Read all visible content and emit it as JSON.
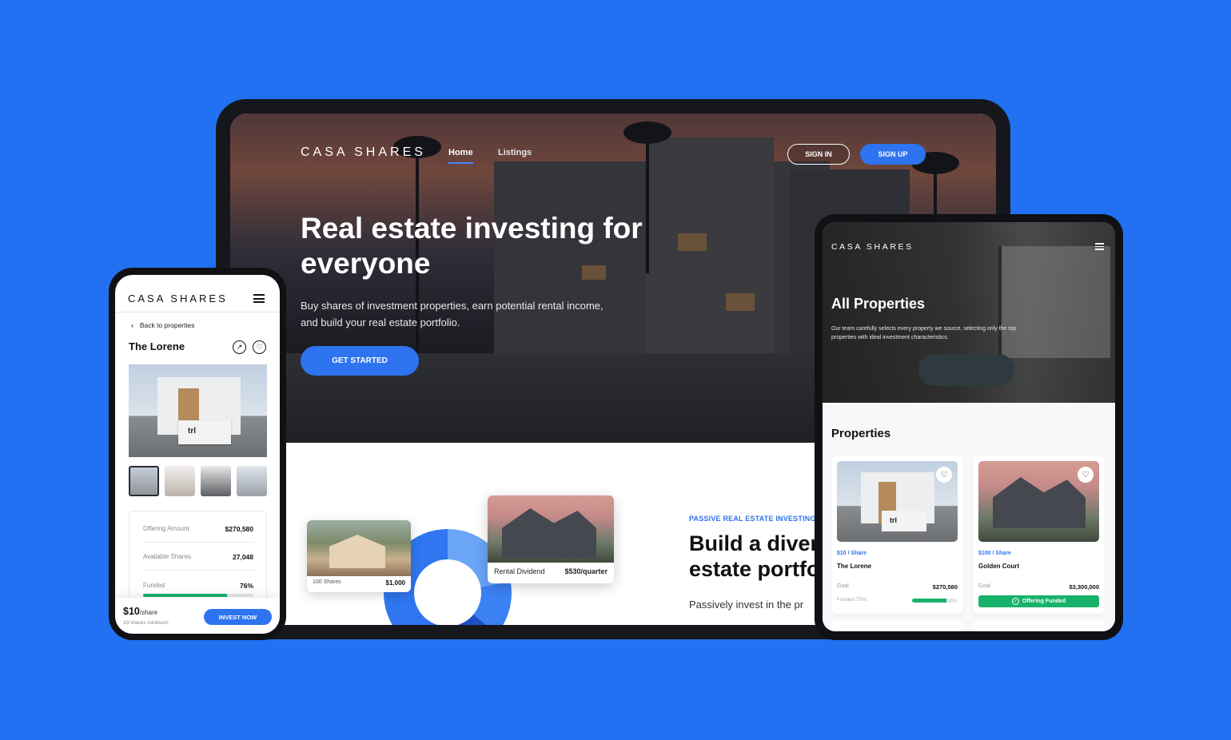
{
  "laptop": {
    "brand": "CASA SHARES",
    "nav": {
      "home": "Home",
      "listings": "Listings"
    },
    "sign_in": "SIGN IN",
    "sign_up": "SIGN UP",
    "hero_title": "Real estate investing for everyone",
    "hero_subtitle": "Buy shares of investment properties, earn potential rental income, and build your real estate portfolio.",
    "cta": "GET STARTED",
    "small_card": {
      "shares": "100 Shares",
      "amount": "$1,000"
    },
    "big_card": {
      "label": "Rental Dividend",
      "value": "$530/quarter"
    },
    "tagline": "PASSIVE REAL ESTATE INVESTING",
    "heading_line1": "Build a diver",
    "heading_line2": "estate portfo",
    "body_text": "Passively invest in the pr",
    "accent": "#2e73ef"
  },
  "phone": {
    "brand": "CASA SHARES",
    "back": "Back to properties",
    "title": "The Lorene",
    "image_sign": "trl",
    "stats": [
      {
        "label": "Offering Amount",
        "value": "$270,580"
      },
      {
        "label": "Available Shares",
        "value": "27,048"
      },
      {
        "label": "Funded",
        "value": "76%"
      }
    ],
    "funded_fraction": 0.76,
    "price": "$10",
    "price_unit": "/share",
    "minimum": "10 shares minimum",
    "invest": "INVEST NOW",
    "icons": [
      "menu-icon",
      "chevron-left-icon",
      "share-icon",
      "heart-icon"
    ]
  },
  "tablet": {
    "brand": "CASA SHARES",
    "hero_title": "All Properties",
    "hero_desc": "Our team carefully selects every property we source, selecting only the top properties with ideal investment characteristics.",
    "section_title": "Properties",
    "cards": [
      {
        "price": "$10 / Share",
        "name": "The Lorene",
        "goal_label": "Goal",
        "goal": "$270,580",
        "funded_label": "Funded 75%",
        "funded_fraction": 0.75,
        "image_sign": "trl"
      },
      {
        "price": "$100 / Share",
        "name": "Golden Court",
        "goal_label": "Goal",
        "goal": "$3,300,000",
        "status": "Offering Funded"
      }
    ],
    "status_color": "#18b26b"
  }
}
